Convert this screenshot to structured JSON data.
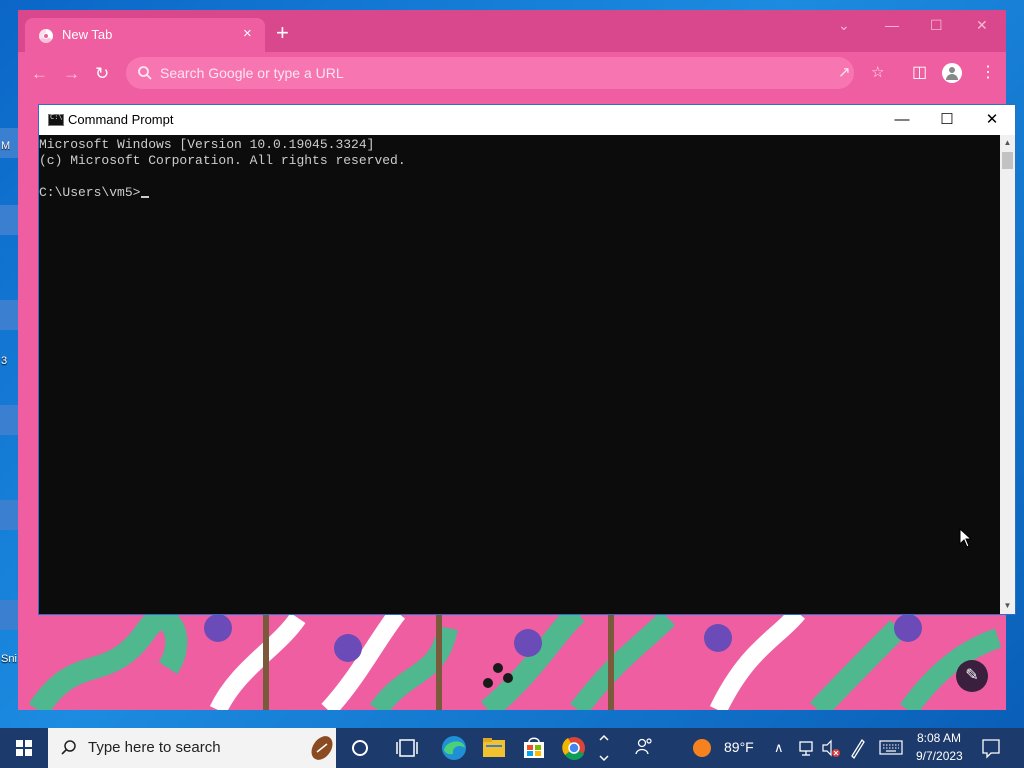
{
  "desktop": {
    "icon_labels": [
      "M",
      "3",
      "Sni"
    ]
  },
  "browser": {
    "tab": {
      "title": "New Tab",
      "close_icon": "×"
    },
    "new_tab_icon": "+",
    "window_controls": {
      "minimize": "—",
      "maximize": "☐",
      "close": "✕",
      "tab_search": "⌄"
    },
    "omnibox": {
      "placeholder": "Search Google or type a URL"
    },
    "accent_color": "#ef5ea0"
  },
  "cmd": {
    "title": "Command Prompt",
    "controls": {
      "minimize": "—",
      "maximize": "☐",
      "close": "✕"
    },
    "lines": [
      "Microsoft Windows [Version 10.0.19045.3324]",
      "(c) Microsoft Corporation. All rights reserved.",
      "",
      "C:\\Users\\vm5>"
    ]
  },
  "taskbar": {
    "search_placeholder": "Type here to search",
    "apps": [
      "cortana-icon",
      "task-view-icon",
      "edge-icon",
      "file-explorer-icon",
      "store-icon",
      "chrome-icon"
    ],
    "weather": {
      "temp": "89°F"
    },
    "clock": {
      "time": "8:08 AM",
      "date": "9/7/2023"
    }
  }
}
